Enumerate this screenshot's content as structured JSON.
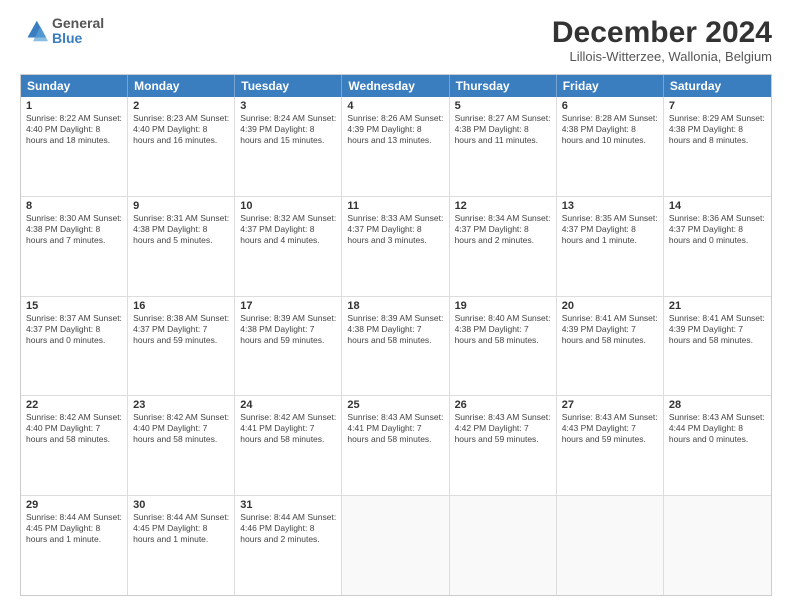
{
  "header": {
    "logo_line1": "General",
    "logo_line2": "Blue",
    "title": "December 2024",
    "location": "Lillois-Witterzee, Wallonia, Belgium"
  },
  "days_of_week": [
    "Sunday",
    "Monday",
    "Tuesday",
    "Wednesday",
    "Thursday",
    "Friday",
    "Saturday"
  ],
  "weeks": [
    [
      {
        "day": "1",
        "info": "Sunrise: 8:22 AM\nSunset: 4:40 PM\nDaylight: 8 hours and 18 minutes."
      },
      {
        "day": "2",
        "info": "Sunrise: 8:23 AM\nSunset: 4:40 PM\nDaylight: 8 hours and 16 minutes."
      },
      {
        "day": "3",
        "info": "Sunrise: 8:24 AM\nSunset: 4:39 PM\nDaylight: 8 hours and 15 minutes."
      },
      {
        "day": "4",
        "info": "Sunrise: 8:26 AM\nSunset: 4:39 PM\nDaylight: 8 hours and 13 minutes."
      },
      {
        "day": "5",
        "info": "Sunrise: 8:27 AM\nSunset: 4:38 PM\nDaylight: 8 hours and 11 minutes."
      },
      {
        "day": "6",
        "info": "Sunrise: 8:28 AM\nSunset: 4:38 PM\nDaylight: 8 hours and 10 minutes."
      },
      {
        "day": "7",
        "info": "Sunrise: 8:29 AM\nSunset: 4:38 PM\nDaylight: 8 hours and 8 minutes."
      }
    ],
    [
      {
        "day": "8",
        "info": "Sunrise: 8:30 AM\nSunset: 4:38 PM\nDaylight: 8 hours and 7 minutes."
      },
      {
        "day": "9",
        "info": "Sunrise: 8:31 AM\nSunset: 4:38 PM\nDaylight: 8 hours and 5 minutes."
      },
      {
        "day": "10",
        "info": "Sunrise: 8:32 AM\nSunset: 4:37 PM\nDaylight: 8 hours and 4 minutes."
      },
      {
        "day": "11",
        "info": "Sunrise: 8:33 AM\nSunset: 4:37 PM\nDaylight: 8 hours and 3 minutes."
      },
      {
        "day": "12",
        "info": "Sunrise: 8:34 AM\nSunset: 4:37 PM\nDaylight: 8 hours and 2 minutes."
      },
      {
        "day": "13",
        "info": "Sunrise: 8:35 AM\nSunset: 4:37 PM\nDaylight: 8 hours and 1 minute."
      },
      {
        "day": "14",
        "info": "Sunrise: 8:36 AM\nSunset: 4:37 PM\nDaylight: 8 hours and 0 minutes."
      }
    ],
    [
      {
        "day": "15",
        "info": "Sunrise: 8:37 AM\nSunset: 4:37 PM\nDaylight: 8 hours and 0 minutes."
      },
      {
        "day": "16",
        "info": "Sunrise: 8:38 AM\nSunset: 4:37 PM\nDaylight: 7 hours and 59 minutes."
      },
      {
        "day": "17",
        "info": "Sunrise: 8:39 AM\nSunset: 4:38 PM\nDaylight: 7 hours and 59 minutes."
      },
      {
        "day": "18",
        "info": "Sunrise: 8:39 AM\nSunset: 4:38 PM\nDaylight: 7 hours and 58 minutes."
      },
      {
        "day": "19",
        "info": "Sunrise: 8:40 AM\nSunset: 4:38 PM\nDaylight: 7 hours and 58 minutes."
      },
      {
        "day": "20",
        "info": "Sunrise: 8:41 AM\nSunset: 4:39 PM\nDaylight: 7 hours and 58 minutes."
      },
      {
        "day": "21",
        "info": "Sunrise: 8:41 AM\nSunset: 4:39 PM\nDaylight: 7 hours and 58 minutes."
      }
    ],
    [
      {
        "day": "22",
        "info": "Sunrise: 8:42 AM\nSunset: 4:40 PM\nDaylight: 7 hours and 58 minutes."
      },
      {
        "day": "23",
        "info": "Sunrise: 8:42 AM\nSunset: 4:40 PM\nDaylight: 7 hours and 58 minutes."
      },
      {
        "day": "24",
        "info": "Sunrise: 8:42 AM\nSunset: 4:41 PM\nDaylight: 7 hours and 58 minutes."
      },
      {
        "day": "25",
        "info": "Sunrise: 8:43 AM\nSunset: 4:41 PM\nDaylight: 7 hours and 58 minutes."
      },
      {
        "day": "26",
        "info": "Sunrise: 8:43 AM\nSunset: 4:42 PM\nDaylight: 7 hours and 59 minutes."
      },
      {
        "day": "27",
        "info": "Sunrise: 8:43 AM\nSunset: 4:43 PM\nDaylight: 7 hours and 59 minutes."
      },
      {
        "day": "28",
        "info": "Sunrise: 8:43 AM\nSunset: 4:44 PM\nDaylight: 8 hours and 0 minutes."
      }
    ],
    [
      {
        "day": "29",
        "info": "Sunrise: 8:44 AM\nSunset: 4:45 PM\nDaylight: 8 hours and 1 minute."
      },
      {
        "day": "30",
        "info": "Sunrise: 8:44 AM\nSunset: 4:45 PM\nDaylight: 8 hours and 1 minute."
      },
      {
        "day": "31",
        "info": "Sunrise: 8:44 AM\nSunset: 4:46 PM\nDaylight: 8 hours and 2 minutes."
      },
      {
        "day": "",
        "info": ""
      },
      {
        "day": "",
        "info": ""
      },
      {
        "day": "",
        "info": ""
      },
      {
        "day": "",
        "info": ""
      }
    ]
  ]
}
